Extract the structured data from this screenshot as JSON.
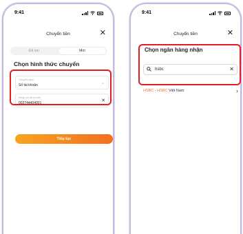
{
  "left_screen": {
    "status_time": "9:41",
    "title": "Chuyển tiền",
    "segments": [
      "Đã lưu",
      "Mới"
    ],
    "section_title": "Chọn hình thức chuyển",
    "method_field": {
      "label": "Chuyển qua",
      "value": "Số tài khoản"
    },
    "account_field": {
      "label": "Nhập số tài khoản",
      "value": "002744404001"
    },
    "continue_label": "Tiếp tục"
  },
  "right_screen": {
    "status_time": "9:41",
    "title": "Chuyển tiền",
    "section_title": "Chọn ngân hàng nhận",
    "search_value": "hsbc",
    "bank_result": {
      "code": "HSBC",
      "separator": " - ",
      "highlight": "HSBC",
      "name": " Việt Nam"
    }
  },
  "colors": {
    "highlight_border": "#e31b23",
    "accent_orange": "#f36f21"
  },
  "icons": [
    "signal-icon",
    "wifi-icon",
    "battery-icon",
    "close-icon",
    "chevron-down-icon",
    "clear-icon",
    "search-icon",
    "chevron-right-icon"
  ]
}
